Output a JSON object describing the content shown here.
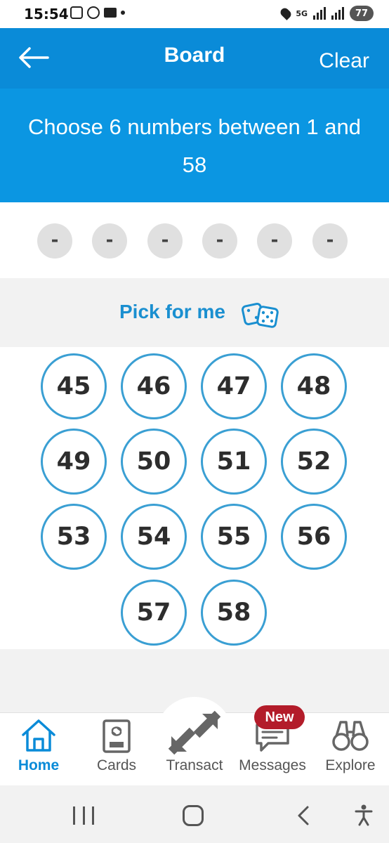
{
  "status_bar": {
    "time": "15:54",
    "network": "5G",
    "battery": "77"
  },
  "header": {
    "title": "Board",
    "clear_label": "Clear"
  },
  "instruction": "Choose 6 numbers between 1 and 58",
  "selection": {
    "slots": [
      "-",
      "-",
      "-",
      "-",
      "-",
      "-"
    ]
  },
  "pick_for_me": {
    "label": "Pick for me",
    "icon": "dice-icon"
  },
  "numbers": [
    "45",
    "46",
    "47",
    "48",
    "49",
    "50",
    "51",
    "52",
    "53",
    "54",
    "55",
    "56",
    "57",
    "58"
  ],
  "bottom_nav": {
    "items": [
      {
        "label": "Home",
        "icon": "home-icon",
        "active": true
      },
      {
        "label": "Cards",
        "icon": "cards-icon",
        "active": false
      },
      {
        "label": "Transact",
        "icon": "transact-icon",
        "active": false
      },
      {
        "label": "Messages",
        "icon": "messages-icon",
        "active": false
      },
      {
        "label": "Explore",
        "icon": "binoculars-icon",
        "active": false
      }
    ],
    "messages_badge": "New"
  },
  "colors": {
    "header": "#0a8bd8",
    "banner": "#0b96e2",
    "accent": "#1a8fd0",
    "ball_border": "#3a9fd3",
    "badge": "#b31c2a"
  }
}
